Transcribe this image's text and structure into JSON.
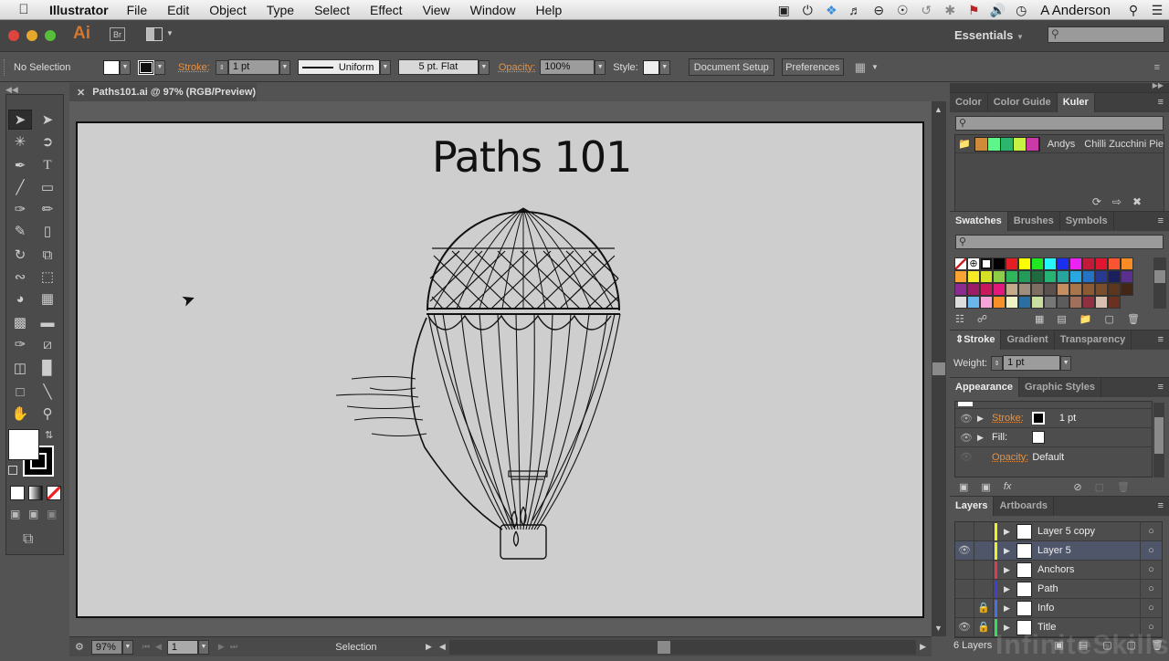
{
  "menubar": {
    "app": "Illustrator",
    "items": [
      "File",
      "Edit",
      "Object",
      "Type",
      "Select",
      "Effect",
      "View",
      "Window",
      "Help"
    ],
    "user": "A Anderson",
    "status_icons": [
      "screen-recorder-icon",
      "power-icon",
      "dropbox-icon",
      "notification-bell-icon",
      "chat-icon",
      "accessibility-icon",
      "time-machine-icon",
      "bluetooth-icon",
      "us-flag-input-icon",
      "volume-icon",
      "clock-icon"
    ]
  },
  "appbar": {
    "logo": "Ai",
    "bridge": "Br",
    "workspace": "Essentials",
    "search_placeholder": ""
  },
  "control": {
    "selection": "No Selection",
    "stroke_label": "Stroke:",
    "stroke_weight": "1 pt",
    "profile": "Uniform",
    "brush": "5 pt. Flat",
    "opacity_label": "Opacity:",
    "opacity": "100%",
    "style_label": "Style:",
    "doc_setup": "Document Setup",
    "preferences": "Preferences"
  },
  "document": {
    "tab": "Paths101.ai @ 97% (RGB/Preview)",
    "artwork_title": "Paths 101"
  },
  "status": {
    "zoom": "97%",
    "artboard": "1",
    "tool": "Selection"
  },
  "color_panel": {
    "tabs": [
      "Color",
      "Color Guide",
      "Kuler"
    ],
    "active": "Kuler",
    "theme_owner": "Andys",
    "theme_name": "Chilli Zucchini Pies",
    "theme_colors": [
      "#d08b3a",
      "#5ef58a",
      "#2db56d",
      "#c8f243",
      "#c93aa6"
    ]
  },
  "swatches_panel": {
    "tabs": [
      "Swatches",
      "Brushes",
      "Symbols"
    ],
    "active": "Swatches",
    "colors": [
      "#ffffff",
      "#ffffff",
      "#ffffff",
      "#000000",
      "#e31e24",
      "#ffff00",
      "#22e822",
      "#26f7ff",
      "#1c2ef0",
      "#ec23f3",
      "#c21a38",
      "#e11530",
      "#f95530",
      "#fa8c25",
      "#fba431",
      "#f5ec26",
      "#d6e226",
      "#8dcc45",
      "#2fb55a",
      "#239c5a",
      "#1f6a3f",
      "#27b373",
      "#26a59c",
      "#29a7e2",
      "#2673c6",
      "#283991",
      "#1c1f5e",
      "#5a308e",
      "#8b2b90",
      "#9b1d66",
      "#c8195c",
      "#e4187a",
      "#c4ab8a",
      "#a08e7c",
      "#7f6f63",
      "#5a514c",
      "#c58e61",
      "#a8764a",
      "#8c5b34",
      "#7a4e2c",
      "#5c3720",
      "#432616",
      "#dddddd",
      "#6ab7ee",
      "#f5a4d8"
    ]
  },
  "stroke_panel": {
    "tabs": [
      "Stroke",
      "Gradient",
      "Transparency"
    ],
    "active": "Stroke",
    "weight_label": "Weight:",
    "weight": "1 pt"
  },
  "appearance_panel": {
    "tabs": [
      "Appearance",
      "Graphic Styles"
    ],
    "active": "Appearance",
    "rows": [
      {
        "label": "Stroke:",
        "value": "1 pt"
      },
      {
        "label": "Fill:",
        "value": ""
      },
      {
        "label": "Opacity:",
        "value": "Default"
      }
    ]
  },
  "layers_panel": {
    "tabs": [
      "Layers",
      "Artboards"
    ],
    "active": "Layers",
    "layers": [
      {
        "name": "Layer 5 copy",
        "color": "#f0f020",
        "visible": false,
        "locked": false
      },
      {
        "name": "Layer 5",
        "color": "#f0f020",
        "visible": true,
        "locked": false,
        "active": true
      },
      {
        "name": "Anchors",
        "color": "#e23a4d",
        "visible": false,
        "locked": false
      },
      {
        "name": "Path",
        "color": "#3e3ee0",
        "visible": false,
        "locked": false
      },
      {
        "name": "Info",
        "color": "#4a6ee8",
        "visible": false,
        "locked": true
      },
      {
        "name": "Title",
        "color": "#2ee05a",
        "visible": true,
        "locked": true
      }
    ],
    "count": "6 Layers"
  },
  "watermark": "InfiniteSkills.com"
}
